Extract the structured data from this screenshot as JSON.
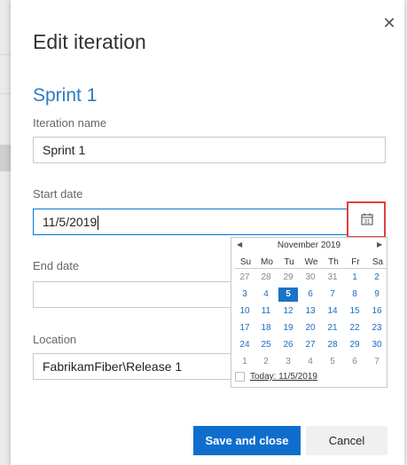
{
  "dialog": {
    "title": "Edit iteration",
    "close_glyph": "✕",
    "subtitle": "Sprint 1"
  },
  "fields": {
    "iteration_name": {
      "label": "Iteration name",
      "value": "Sprint 1"
    },
    "start_date": {
      "label": "Start date",
      "value": "11/5/2019"
    },
    "end_date": {
      "label": "End date",
      "value": ""
    },
    "location": {
      "label": "Location",
      "value": "FabrikamFiber\\Release 1"
    }
  },
  "calendar": {
    "month_label": "November 2019",
    "prev_glyph": "◀",
    "next_glyph": "▶",
    "icon_number": "31",
    "weekdays": [
      "Su",
      "Mo",
      "Tu",
      "We",
      "Th",
      "Fr",
      "Sa"
    ],
    "weeks": [
      [
        {
          "d": "27",
          "t": "other"
        },
        {
          "d": "28",
          "t": "other"
        },
        {
          "d": "29",
          "t": "other"
        },
        {
          "d": "30",
          "t": "other"
        },
        {
          "d": "31",
          "t": "other"
        },
        {
          "d": "1",
          "t": "cur"
        },
        {
          "d": "2",
          "t": "cur"
        }
      ],
      [
        {
          "d": "3",
          "t": "cur"
        },
        {
          "d": "4",
          "t": "cur"
        },
        {
          "d": "5",
          "t": "sel"
        },
        {
          "d": "6",
          "t": "cur"
        },
        {
          "d": "7",
          "t": "cur"
        },
        {
          "d": "8",
          "t": "cur"
        },
        {
          "d": "9",
          "t": "cur"
        }
      ],
      [
        {
          "d": "10",
          "t": "cur"
        },
        {
          "d": "11",
          "t": "cur"
        },
        {
          "d": "12",
          "t": "cur"
        },
        {
          "d": "13",
          "t": "cur"
        },
        {
          "d": "14",
          "t": "cur"
        },
        {
          "d": "15",
          "t": "cur"
        },
        {
          "d": "16",
          "t": "cur"
        }
      ],
      [
        {
          "d": "17",
          "t": "cur"
        },
        {
          "d": "18",
          "t": "cur"
        },
        {
          "d": "19",
          "t": "cur"
        },
        {
          "d": "20",
          "t": "cur"
        },
        {
          "d": "21",
          "t": "cur"
        },
        {
          "d": "22",
          "t": "cur"
        },
        {
          "d": "23",
          "t": "cur"
        }
      ],
      [
        {
          "d": "24",
          "t": "cur"
        },
        {
          "d": "25",
          "t": "cur"
        },
        {
          "d": "26",
          "t": "cur"
        },
        {
          "d": "27",
          "t": "cur"
        },
        {
          "d": "28",
          "t": "cur"
        },
        {
          "d": "29",
          "t": "cur"
        },
        {
          "d": "30",
          "t": "cur"
        }
      ],
      [
        {
          "d": "1",
          "t": "other"
        },
        {
          "d": "2",
          "t": "other"
        },
        {
          "d": "3",
          "t": "other"
        },
        {
          "d": "4",
          "t": "other"
        },
        {
          "d": "5",
          "t": "other"
        },
        {
          "d": "6",
          "t": "other"
        },
        {
          "d": "7",
          "t": "other"
        }
      ]
    ],
    "today_label": "Today: 11/5/2019"
  },
  "buttons": {
    "save": "Save and close",
    "cancel": "Cancel"
  },
  "colors": {
    "accent": "#0f6ecd",
    "highlight_border": "#e04040",
    "subtitle": "#2b7bc2"
  }
}
